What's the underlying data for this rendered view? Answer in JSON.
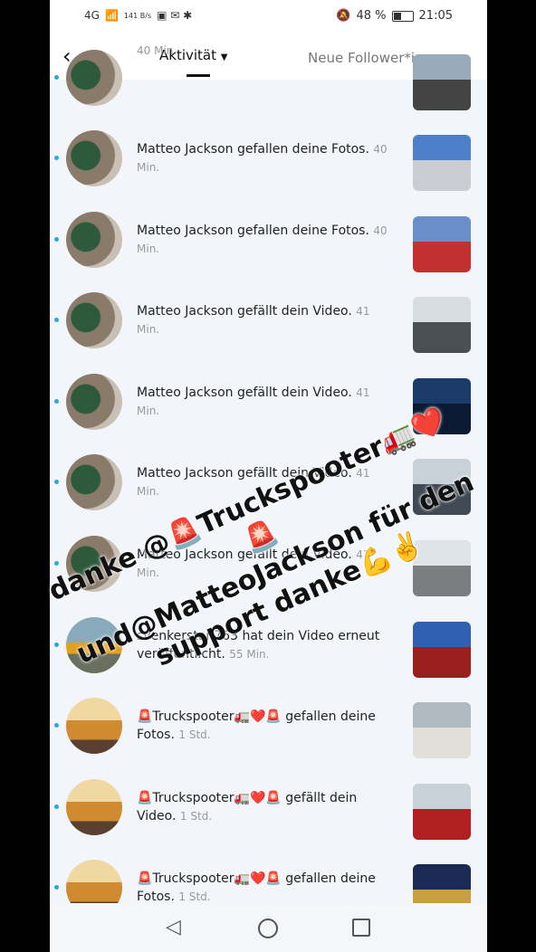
{
  "status": {
    "network": "4G",
    "speed": "141 B/s",
    "battery": "48 %",
    "battery_level": 0.48,
    "time": "21:05"
  },
  "tabs": {
    "active": "Aktivität",
    "inactive": "Neue Follower*inne"
  },
  "notifications": [
    {
      "text": "",
      "time": "40 Min.",
      "avatar": "green",
      "thumb": [
        "#9ab",
        "#444"
      ]
    },
    {
      "text": "Matteo Jackson gefallen deine Fotos.",
      "time": "40 Min.",
      "avatar": "green",
      "thumb": [
        "#4d7fc8",
        "#c9ccd0"
      ]
    },
    {
      "text": "Matteo Jackson gefallen deine Fotos.",
      "time": "40 Min.",
      "avatar": "green",
      "thumb": [
        "#6a8fc8",
        "#c23030"
      ]
    },
    {
      "text": "Matteo Jackson gefällt dein Video.",
      "time": "41 Min.",
      "avatar": "green",
      "thumb": [
        "#d8dde2",
        "#4a4e55"
      ]
    },
    {
      "text": "Matteo Jackson gefällt dein Video.",
      "time": "41 Min.",
      "avatar": "green",
      "thumb": [
        "#1a3a6a",
        "#0a1a33"
      ]
    },
    {
      "text": "Matteo Jackson gefällt dein Video.",
      "time": "41 Min.",
      "avatar": "green",
      "thumb": [
        "#c8d0d8",
        "#404a55"
      ]
    },
    {
      "text": "Matteo Jackson gefällt dein Video.",
      "time": "41 Min.",
      "avatar": "green",
      "thumb": [
        "#dfe4e8",
        "#7a7e80"
      ]
    },
    {
      "text": "svenkerstan763 hat dein Video erneut veröffentlicht.",
      "time": "55 Min.",
      "avatar": "yard",
      "thumb": [
        "#3060b0",
        "#9a2020"
      ]
    },
    {
      "text": "🚨Truckspooter🚛❤️🚨 gefallen deine Fotos.",
      "time": "1 Std.",
      "avatar": "truck",
      "thumb": [
        "#b0b8c0",
        "#e0e0d8"
      ]
    },
    {
      "text": "🚨Truckspooter🚛❤️🚨 gefällt dein Video.",
      "time": "1 Std.",
      "avatar": "truck",
      "thumb": [
        "#c8d0d8",
        "#b02020"
      ]
    },
    {
      "text": "🚨Truckspooter🚛❤️🚨 gefallen deine Fotos.",
      "time": "1 Std.",
      "avatar": "truck",
      "thumb": [
        "#1a2a55",
        "#c8a040"
      ]
    }
  ],
  "overlay": {
    "line1": "danke @🚨Truckspooter🚛❤️🚨",
    "line2": "und@MatteoJackson  für den",
    "line3": "support danke💪✌️"
  }
}
